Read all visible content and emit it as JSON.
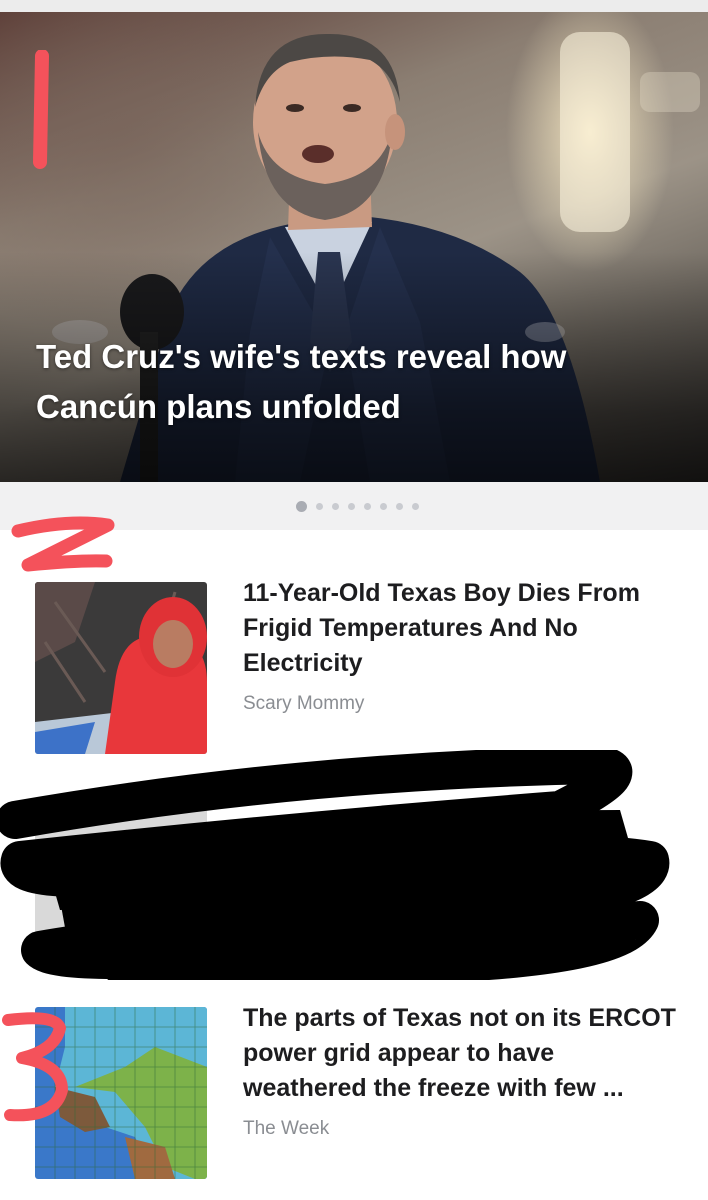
{
  "hero": {
    "headline": "Ted Cruz's wife's texts reveal how Cancún plans unfolded",
    "image_alt": "man-speaking-at-microphone"
  },
  "carousel": {
    "dot_count": 8,
    "active_index": 0
  },
  "articles": [
    {
      "headline": "11-Year-Old Texas Boy Dies From Frigid Temperatures And No Electricity",
      "source": "Scary Mommy",
      "thumbnail": "boy-in-red-hoodie-snow"
    },
    {
      "headline": "",
      "source": "",
      "thumbnail": "redacted",
      "redacted": true
    },
    {
      "headline": "The parts of Texas not on its ERCOT power grid appear to have weathered the freeze with few ...",
      "source": "The Week",
      "thumbnail": "texas-grid-map"
    }
  ],
  "annotations": {
    "marker_color": "#f4525b",
    "labels": [
      "1",
      "2",
      "3"
    ]
  }
}
